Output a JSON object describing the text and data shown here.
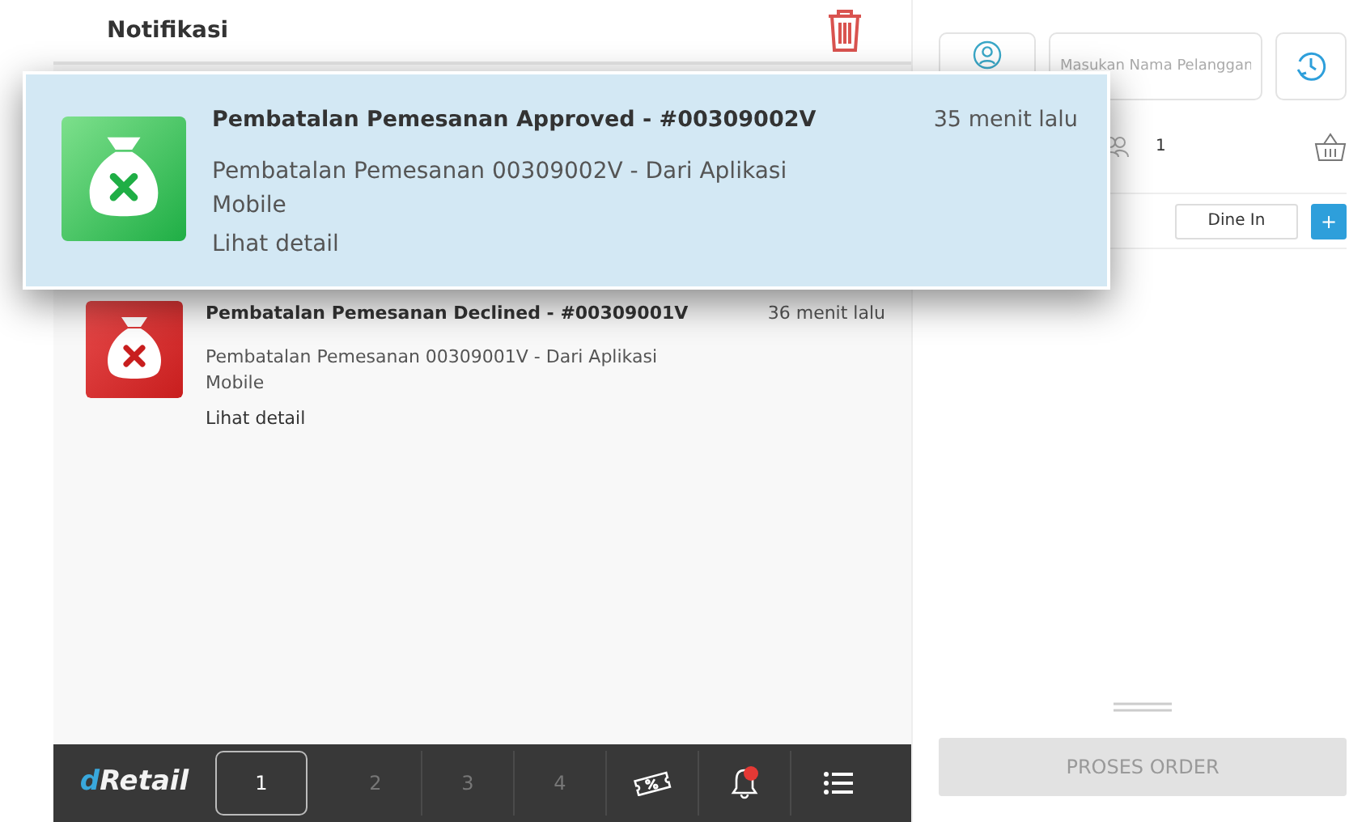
{
  "notifications": {
    "title": "Notifikasi",
    "items": [
      {
        "kind": "approved",
        "highlighted": true,
        "title": "Pembatalan Pemesanan Approved - #00309002V",
        "time": "35 menit lalu",
        "message": "Pembatalan Pemesanan 00309002V - Dari Aplikasi Mobile",
        "link": "Lihat detail"
      },
      {
        "kind": "declined",
        "highlighted": false,
        "title": "Pembatalan Pemesanan Declined - #00309001V",
        "time": "36 menit lalu",
        "message": "Pembatalan Pemesanan 00309001V - Dari Aplikasi Mobile",
        "link": "Lihat detail"
      }
    ]
  },
  "bottom_bar": {
    "logo": "dRetail",
    "tabs": [
      {
        "label": "1",
        "selected": true
      },
      {
        "label": "2",
        "selected": false
      },
      {
        "label": "3",
        "selected": false
      },
      {
        "label": "4",
        "selected": false
      }
    ],
    "notification_unread": true
  },
  "order_panel": {
    "customer_placeholder": "Masukan Nama Pelanggan",
    "guests": "1",
    "order_type": "Dine In",
    "add_button": "+",
    "submit_button": {
      "label": "PROSES ORDER",
      "disabled": true
    }
  }
}
